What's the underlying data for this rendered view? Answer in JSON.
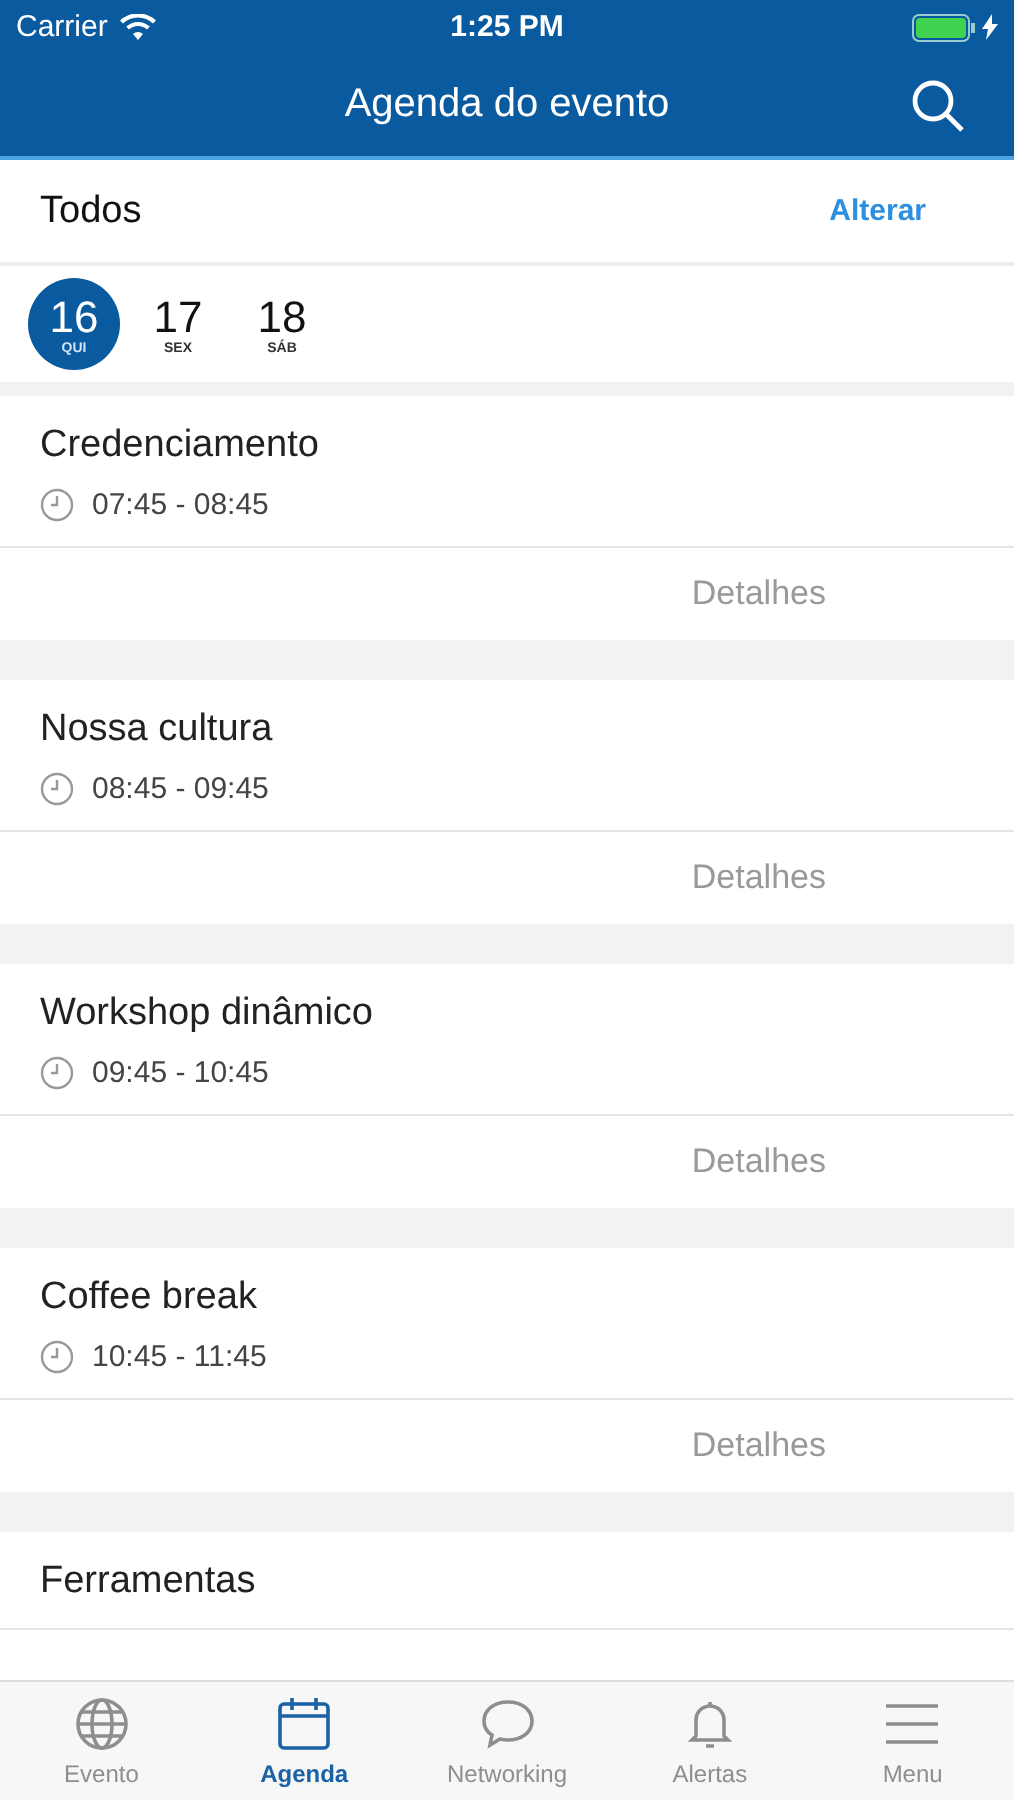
{
  "status_bar": {
    "carrier": "Carrier",
    "time": "1:25 PM"
  },
  "nav_bar": {
    "title": "Agenda do evento"
  },
  "filter": {
    "label": "Todos",
    "action": "Alterar"
  },
  "dates": [
    {
      "day": "16",
      "weekday": "QUI",
      "selected": true
    },
    {
      "day": "17",
      "weekday": "SEX",
      "selected": false
    },
    {
      "day": "18",
      "weekday": "SÁB",
      "selected": false
    }
  ],
  "sessions": [
    {
      "title": "Credenciamento",
      "time": "07:45 - 08:45",
      "details": "Detalhes"
    },
    {
      "title": "Nossa cultura",
      "time": "08:45 - 09:45",
      "details": "Detalhes"
    },
    {
      "title": "Workshop dinâmico",
      "time": "09:45 - 10:45",
      "details": "Detalhes"
    },
    {
      "title": "Coffee break",
      "time": "10:45 - 11:45",
      "details": "Detalhes"
    },
    {
      "title": "Ferramentas"
    }
  ],
  "tab_bar": [
    {
      "kind": "globe",
      "label": "Evento",
      "selected": false
    },
    {
      "kind": "calendar",
      "label": "Agenda",
      "selected": true
    },
    {
      "kind": "chat",
      "label": "Networking",
      "selected": false
    },
    {
      "kind": "bell",
      "label": "Alertas",
      "selected": false
    },
    {
      "kind": "menu",
      "label": "Menu",
      "selected": false
    }
  ]
}
